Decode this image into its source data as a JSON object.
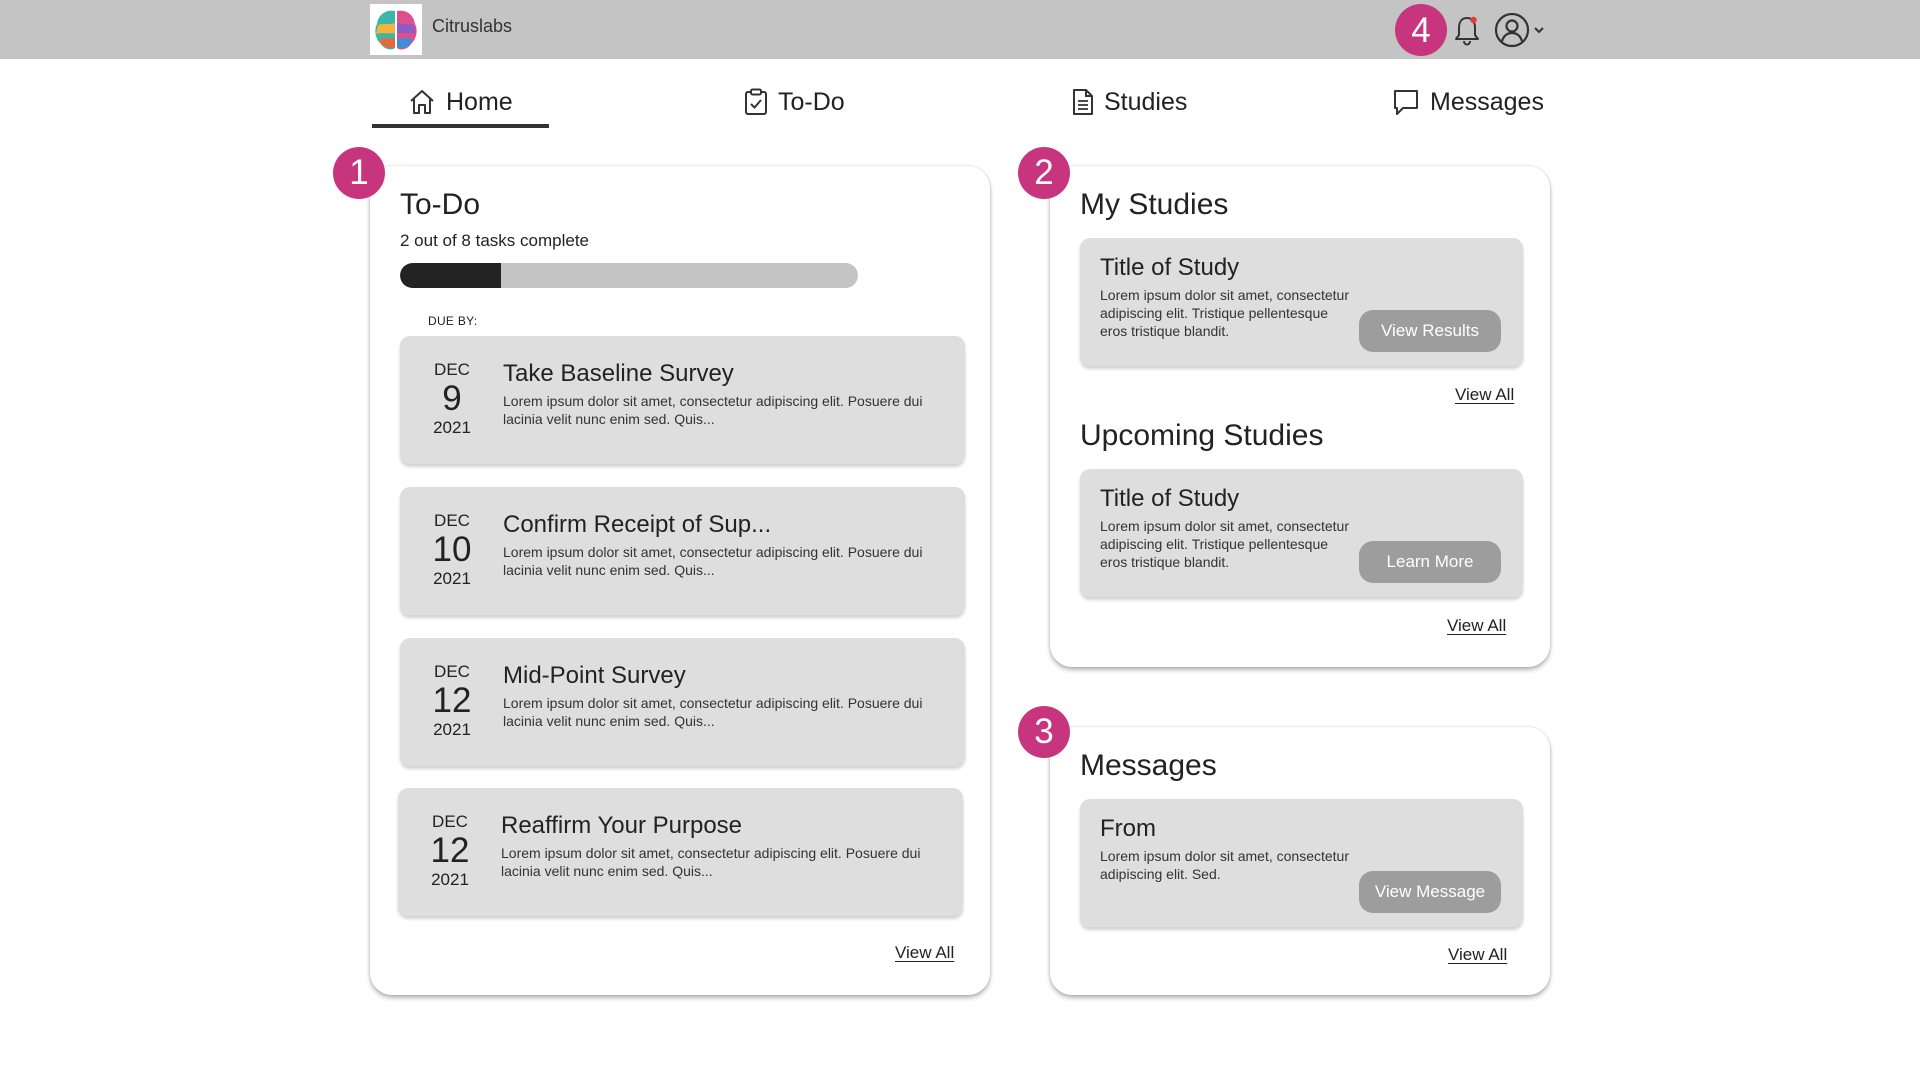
{
  "header": {
    "brand": "Citruslabs",
    "annotation": "4",
    "icons": {
      "logo": "brain-logo-icon",
      "bell": "bell-icon",
      "account": "user-circle-icon",
      "dropdown": "chevron-down-icon"
    }
  },
  "tabs": [
    {
      "label": "Home",
      "icon": "home-icon",
      "active": true
    },
    {
      "label": "To-Do",
      "icon": "clipboard-icon",
      "active": false
    },
    {
      "label": "Studies",
      "icon": "document-icon",
      "active": false
    },
    {
      "label": "Messages",
      "icon": "chat-icon",
      "active": false
    }
  ],
  "todo": {
    "annotation": "1",
    "title": "To-Do",
    "progress_text": "2 out of 8 tasks complete",
    "progress_fraction": 0.22,
    "due_by": "DUE BY:",
    "tasks": [
      {
        "month": "DEC",
        "day": "9",
        "year": "2021",
        "title": "Take Baseline Survey",
        "desc": "Lorem ipsum dolor sit amet, consectetur adipiscing elit. Posuere dui lacinia velit nunc enim sed. Quis..."
      },
      {
        "month": "DEC",
        "day": "10",
        "year": "2021",
        "title": "Confirm Receipt of Sup...",
        "desc": "Lorem ipsum dolor sit amet, consectetur adipiscing elit. Posuere dui lacinia velit nunc enim sed. Quis..."
      },
      {
        "month": "DEC",
        "day": "12",
        "year": "2021",
        "title": "Mid-Point Survey",
        "desc": "Lorem ipsum dolor sit amet, consectetur adipiscing elit. Posuere dui lacinia velit nunc enim sed. Quis..."
      },
      {
        "month": "DEC",
        "day": "12",
        "year": "2021",
        "title": "Reaffirm Your Purpose",
        "desc": "Lorem ipsum dolor sit amet, consectetur adipiscing elit. Posuere dui lacinia velit nunc enim sed. Quis..."
      }
    ],
    "view_all": "View All"
  },
  "studies": {
    "annotation": "2",
    "my_title": "My Studies",
    "my_study": {
      "title": "Title of Study",
      "desc": "Lorem ipsum dolor sit amet, consectetur adipiscing elit. Tristique pellentesque eros tristique blandit.",
      "button": "View Results"
    },
    "my_view_all": "View All",
    "upcoming_title": "Upcoming Studies",
    "upcoming_study": {
      "title": "Title of Study",
      "desc": "Lorem ipsum dolor sit amet, consectetur adipiscing elit. Tristique pellentesque eros tristique blandit.",
      "button": "Learn More"
    },
    "upcoming_view_all": "View All"
  },
  "messages": {
    "annotation": "3",
    "title": "Messages",
    "item": {
      "title": "From",
      "desc": "Lorem ipsum dolor sit amet, consectetur adipiscing elit. Sed.",
      "button": "View Message"
    },
    "view_all": "View All"
  },
  "colors": {
    "accent": "#c8357f",
    "topbar": "#c4c4c4",
    "card_item": "#dedede",
    "button": "#9d9d9d",
    "progress_fill": "#232323"
  }
}
